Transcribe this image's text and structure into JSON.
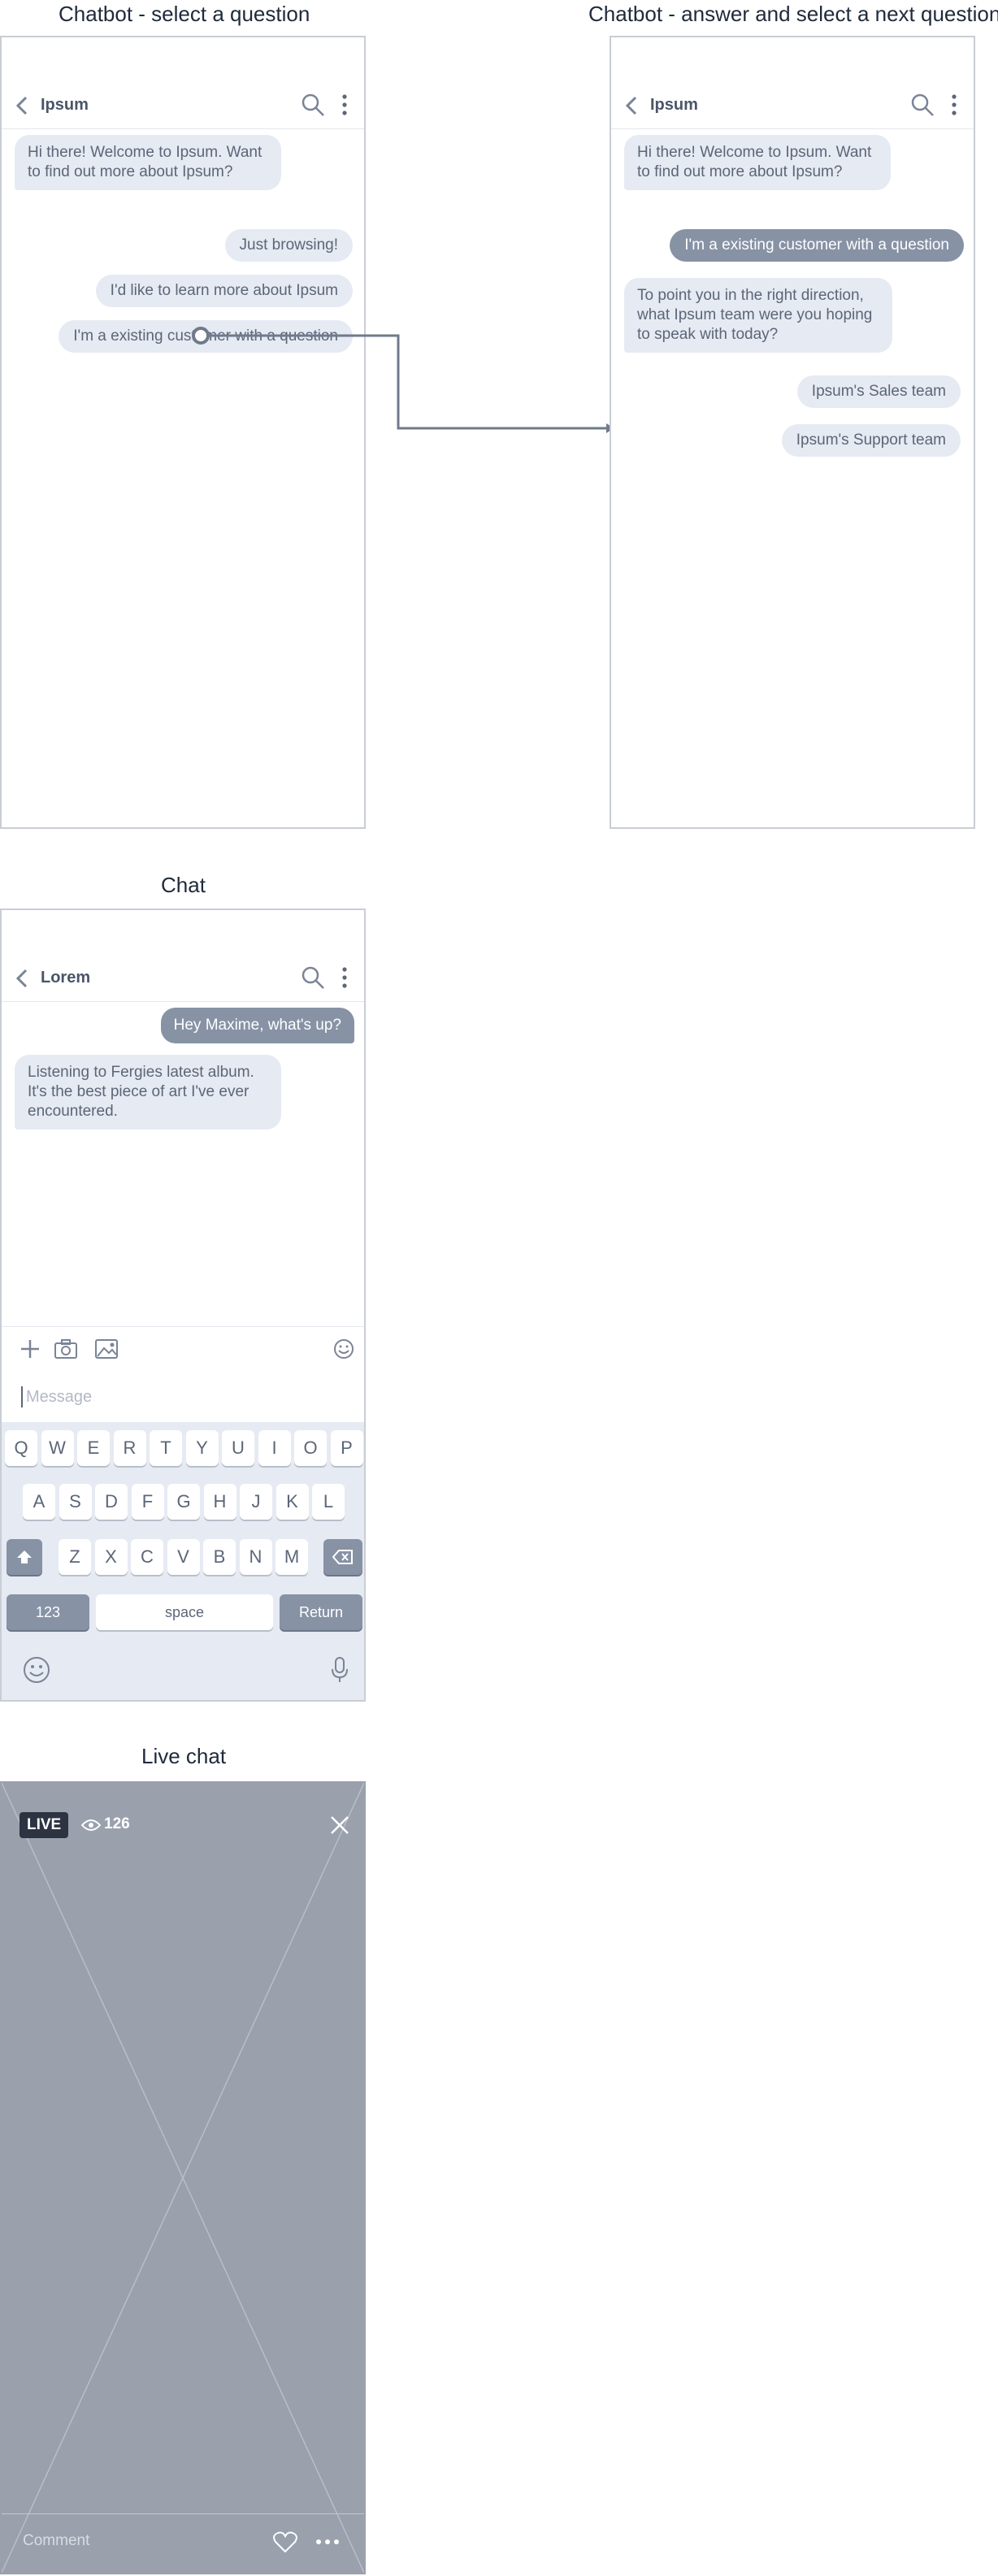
{
  "screens": {
    "chatbot_select": {
      "label": "Chatbot - select a question",
      "app_title": "Ipsum",
      "welcome": "Hi there! Welcome to Ipsum. Want to find out more about Ipsum?",
      "options": [
        "Just browsing!",
        "I'd like to learn more about Ipsum",
        "I'm a existing customer with a question"
      ]
    },
    "chatbot_answer": {
      "label": "Chatbot - answer and select a next question",
      "app_title": "Ipsum",
      "welcome": "Hi there! Welcome to Ipsum. Want to find out more about Ipsum?",
      "selected": "I'm a existing customer with a question",
      "bot_reply": "To point you in the right direction, what Ipsum team were you hoping to speak with today?",
      "options": [
        "Ipsum's Sales team",
        "Ipsum's Support team"
      ]
    },
    "chat": {
      "label": "Chat",
      "app_title": "Lorem",
      "sent": "Hey Maxime, what's up?",
      "received": "Listening to Fergies latest album. It's the best piece of art I've ever encountered.",
      "message_placeholder": "Message",
      "keyboard": {
        "row1": [
          "Q",
          "W",
          "E",
          "R",
          "T",
          "Y",
          "U",
          "I",
          "O",
          "P"
        ],
        "row2": [
          "A",
          "S",
          "D",
          "F",
          "G",
          "H",
          "J",
          "K",
          "L"
        ],
        "row3": [
          "Z",
          "X",
          "C",
          "V",
          "B",
          "N",
          "M"
        ],
        "numbers_key": "123",
        "space_key": "space",
        "return_key": "Return"
      }
    },
    "live_chat": {
      "label": "Live chat",
      "live_badge": "LIVE",
      "viewer_count": "126",
      "comment_placeholder": "Comment"
    }
  },
  "colors": {
    "bubble": "#e6eaf2",
    "accent": "#8792a5",
    "frame_border": "#c9cdd4",
    "video_bg": "#9aa1ad"
  }
}
